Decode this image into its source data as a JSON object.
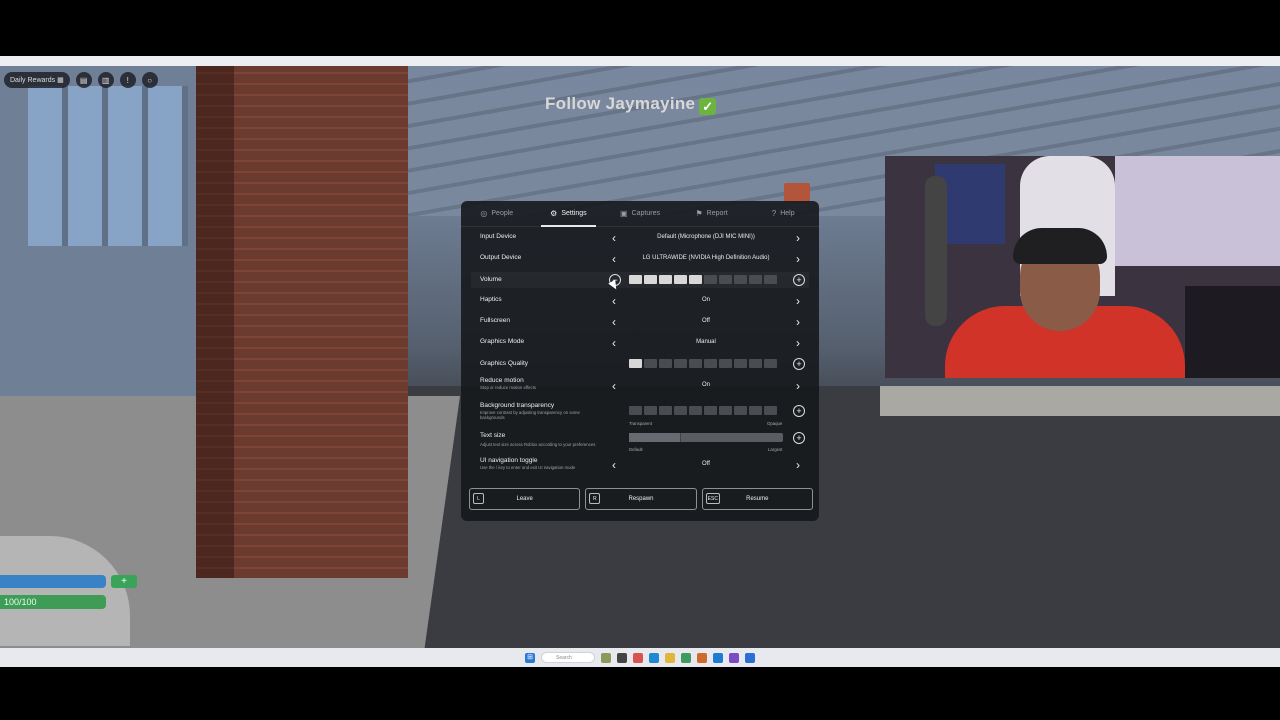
{
  "hud": {
    "daily_rewards": "Daily Rewards",
    "overlay_text": "Follow Jaymayine",
    "overlay_check": "✓",
    "health_text": "100/100",
    "plus": "+"
  },
  "menu": {
    "tabs": [
      {
        "label": "People",
        "icon": "people-icon",
        "glyph": "◎"
      },
      {
        "label": "Settings",
        "icon": "gear-icon",
        "glyph": "⚙"
      },
      {
        "label": "Captures",
        "icon": "camera-icon",
        "glyph": "▣"
      },
      {
        "label": "Report",
        "icon": "flag-icon",
        "glyph": "⚑"
      },
      {
        "label": "Help",
        "icon": "help-icon",
        "glyph": "?"
      }
    ],
    "active_tab": "Settings",
    "settings": {
      "input_device": {
        "label": "Input Device",
        "value": "Default (Microphone (DJI MIC MINI))"
      },
      "output_device": {
        "label": "Output Device",
        "value": "LG ULTRAWIDE (NVIDIA High Definition Audio)"
      },
      "volume": {
        "label": "Volume",
        "level": 5,
        "max": 10
      },
      "haptics": {
        "label": "Haptics",
        "value": "On"
      },
      "fullscreen": {
        "label": "Fullscreen",
        "value": "Off"
      },
      "graphics_mode": {
        "label": "Graphics Mode",
        "value": "Manual"
      },
      "graphics_quality": {
        "label": "Graphics Quality",
        "level": 1,
        "max": 10
      },
      "reduce_motion": {
        "label": "Reduce motion",
        "description": "Stop or reduce motion effects",
        "value": "On"
      },
      "background_transparency": {
        "label": "Background transparency",
        "description": "Improve contrast by adjusting transparency on some backgrounds",
        "level": 0,
        "max": 10,
        "min_label": "Transparent",
        "max_label": "Opaque"
      },
      "text_size": {
        "label": "Text size",
        "description": "Adjust text size across Roblox according to your preferences",
        "level": 1,
        "max": 3,
        "min_label": "Default",
        "max_label": "Largest"
      },
      "ui_navigation_toggle": {
        "label": "UI navigation toggle",
        "description": "Use the \\ key to enter and exit UI navigation mode",
        "value": "Off"
      }
    },
    "actions": [
      {
        "key": "L",
        "label": "Leave"
      },
      {
        "key": "R",
        "label": "Respawn"
      },
      {
        "key": "ESC",
        "label": "Resume"
      }
    ]
  },
  "taskbar": {
    "search_placeholder": "Search"
  },
  "colors": {
    "panel_bg": "#16181c",
    "health_blue": "#3a82c6",
    "health_green": "#3e9c57",
    "check_green": "#6cb33f",
    "shirt_red": "#d23328"
  }
}
